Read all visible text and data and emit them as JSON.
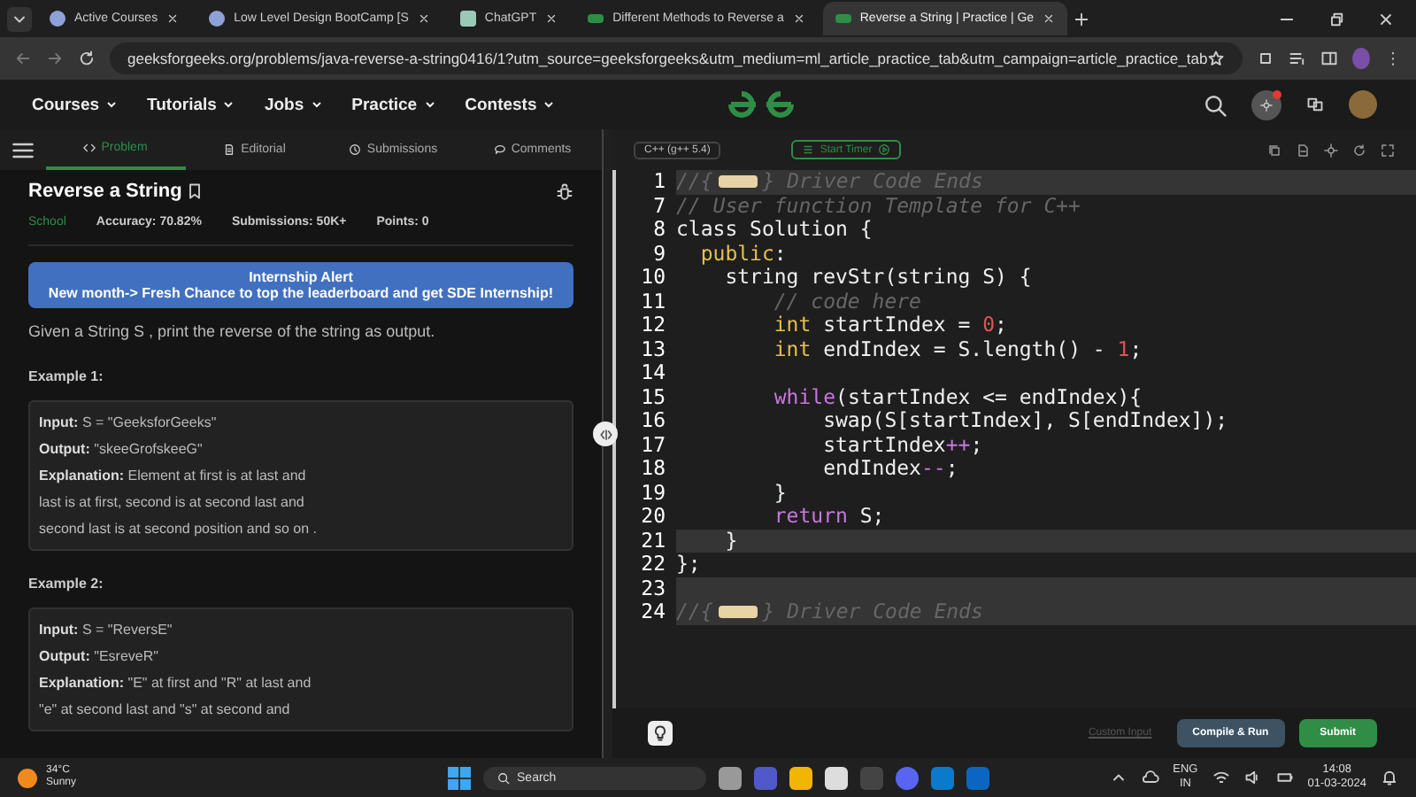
{
  "browser_tabs": [
    {
      "title": "Active Courses",
      "selected": false
    },
    {
      "title": "Low Level Design BootCamp [S",
      "selected": false
    },
    {
      "title": "ChatGPT",
      "selected": false
    },
    {
      "title": "Different Methods to Reverse a",
      "selected": false
    },
    {
      "title": "Reverse a String | Practice | Ge",
      "selected": true
    }
  ],
  "address_bar": {
    "url": "geeksforgeeks.org/problems/java-reverse-a-string0416/1?utm_source=geeksforgeeks&utm_medium=ml_article_practice_tab&utm_campaign=article_practice_tab"
  },
  "site_nav": {
    "items": [
      "Courses",
      "Tutorials",
      "Jobs",
      "Practice",
      "Contests"
    ],
    "notification": true
  },
  "problem_tabs": [
    {
      "label": "Problem",
      "selected": true
    },
    {
      "label": "Editorial",
      "selected": false
    },
    {
      "label": "Submissions",
      "selected": false
    },
    {
      "label": "Comments",
      "selected": false
    }
  ],
  "problem": {
    "title": "Reverse a String",
    "difficulty": "School",
    "stats": [
      "Accuracy: 70.82%",
      "Submissions: 50K+",
      "Points: 0"
    ],
    "alert": {
      "title": "Internship Alert",
      "text": "New month-> Fresh Chance to top the leaderboard and get SDE Internship!"
    },
    "description": "Given a String S , print the reverse of the string as output.",
    "examples": [
      {
        "heading": "Example 1:",
        "lines": [
          "**Input:** S = \"GeeksforGeeks\"",
          "**Output:** \"skeeGrofskeeG\"",
          "**Explanation:** Element at first is at last and",
          "last is at first, second is at second last and",
          "second last is at second position and so on ."
        ]
      },
      {
        "heading": "Example 2:",
        "lines": [
          "**Input:** S = \"ReversE\"",
          "**Output:** \"EsreveR\"",
          "**Explanation:** \"E\" at first and \"R\" at last and",
          "\"e\" at second last and \"s\" at second and"
        ]
      }
    ]
  },
  "editor": {
    "language": "C++ (g++ 5.4)",
    "timer_label": "Start Timer",
    "lines": [
      {
        "number": "1",
        "highlighted": true,
        "tokens": [
          {
            "kind": "comment",
            "text": "//{"
          },
          {
            "kind": "fold"
          },
          {
            "kind": "comment",
            "text": "} Driver Code Ends"
          }
        ]
      },
      {
        "number": "7",
        "highlighted": false,
        "tokens": [
          {
            "kind": "comment",
            "text": "// User function Template for C++"
          }
        ]
      },
      {
        "number": "8",
        "highlighted": false,
        "tokens": [
          {
            "kind": "plain",
            "text": "class Solution {"
          }
        ]
      },
      {
        "number": "9",
        "highlighted": false,
        "tokens": [
          {
            "kind": "keyword",
            "text": "  public"
          },
          {
            "kind": "plain",
            "text": ":"
          }
        ]
      },
      {
        "number": "10",
        "highlighted": false,
        "tokens": [
          {
            "kind": "plain",
            "text": "    string revStr(string S) {"
          }
        ]
      },
      {
        "number": "11",
        "highlighted": false,
        "tokens": [
          {
            "kind": "comment",
            "text": "        // code here"
          }
        ]
      },
      {
        "number": "12",
        "highlighted": false,
        "tokens": [
          {
            "kind": "keyword",
            "text": "        int"
          },
          {
            "kind": "plain",
            "text": " startIndex = "
          },
          {
            "kind": "number",
            "text": "0"
          },
          {
            "kind": "plain",
            "text": ";"
          }
        ]
      },
      {
        "number": "13",
        "highlighted": false,
        "tokens": [
          {
            "kind": "keyword",
            "text": "        int"
          },
          {
            "kind": "plain",
            "text": " endIndex = S.length() - "
          },
          {
            "kind": "number",
            "text": "1"
          },
          {
            "kind": "plain",
            "text": ";"
          }
        ]
      },
      {
        "number": "14",
        "highlighted": false
      },
      {
        "number": "15",
        "highlighted": false,
        "tokens": [
          {
            "kind": "control",
            "text": "        while"
          },
          {
            "kind": "plain",
            "text": "(startIndex <= endIndex){"
          }
        ]
      },
      {
        "number": "16",
        "highlighted": false,
        "tokens": [
          {
            "kind": "plain",
            "text": "            swap(S[startIndex], S[endIndex]);"
          }
        ]
      },
      {
        "number": "17",
        "highlighted": false,
        "tokens": [
          {
            "kind": "plain",
            "text": "            startIndex"
          },
          {
            "kind": "control",
            "text": "++"
          },
          {
            "kind": "plain",
            "text": ";"
          }
        ]
      },
      {
        "number": "18",
        "highlighted": false,
        "tokens": [
          {
            "kind": "plain",
            "text": "            endIndex"
          },
          {
            "kind": "control",
            "text": "--"
          },
          {
            "kind": "plain",
            "text": ";"
          }
        ]
      },
      {
        "number": "19",
        "highlighted": false,
        "tokens": [
          {
            "kind": "plain",
            "text": "        }"
          }
        ]
      },
      {
        "number": "20",
        "highlighted": false,
        "tokens": [
          {
            "kind": "control",
            "text": "        return"
          },
          {
            "kind": "plain",
            "text": " S;"
          }
        ]
      },
      {
        "number": "21",
        "highlighted": true,
        "tokens": [
          {
            "kind": "plain",
            "text": "    }"
          }
        ]
      },
      {
        "number": "22",
        "highlighted": false,
        "tokens": [
          {
            "kind": "plain",
            "text": "};"
          }
        ]
      },
      {
        "number": "23",
        "highlighted": true
      },
      {
        "number": "24",
        "highlighted": true,
        "tokens": [
          {
            "kind": "comment",
            "text": "//{"
          },
          {
            "kind": "fold"
          },
          {
            "kind": "comment",
            "text": "} Driver Code Ends"
          }
        ]
      }
    ],
    "custom_input": "Custom Input",
    "compile_button": "Compile & Run",
    "submit_button": "Submit"
  },
  "taskbar": {
    "temperature": "34°C",
    "weather": "Sunny",
    "search": "Search",
    "language": "ENG",
    "region": "IN",
    "time": "14:08",
    "date": "01-03-2024"
  }
}
